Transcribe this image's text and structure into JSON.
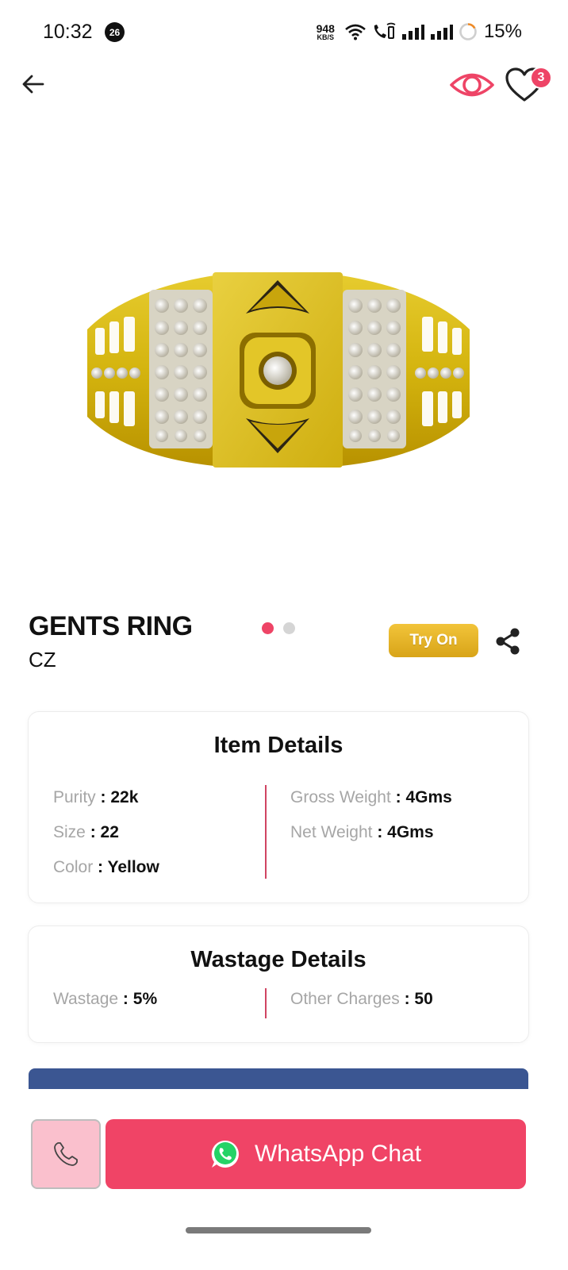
{
  "status_bar": {
    "time": "10:32",
    "notification_count": "26",
    "net_speed_value": "948",
    "net_speed_unit": "KB/S",
    "battery": "15%"
  },
  "header": {
    "wishlist_count": "3"
  },
  "product": {
    "title": "GENTS RING",
    "subtitle": "CZ",
    "image_count": 2,
    "active_image": 1,
    "try_on_label": "Try On"
  },
  "item_details": {
    "title": "Item Details",
    "purity": {
      "label": "Purity",
      "value": "22k"
    },
    "size": {
      "label": "Size",
      "value": "22"
    },
    "color": {
      "label": "Color",
      "value": "Yellow"
    },
    "gross_weight": {
      "label": "Gross Weight",
      "value": "4Gms"
    },
    "net_weight": {
      "label": "Net Weight",
      "value": "4Gms"
    }
  },
  "wastage_details": {
    "title": "Wastage Details",
    "wastage": {
      "label": "Wastage",
      "value": "5%"
    },
    "other_charges": {
      "label": "Other Charges",
      "value": "50"
    }
  },
  "actions": {
    "whatsapp_label": "WhatsApp Chat"
  },
  "colors": {
    "accent": "#ee4466",
    "gold": "#d8a418",
    "whatsapp_green": "#25d366",
    "call_bg": "#fac0cd",
    "strip_blue": "#3b5692"
  },
  "icons": {
    "back": "arrow-left-icon",
    "view": "eye-icon",
    "wishlist": "heart-icon",
    "share": "share-icon",
    "call": "phone-icon",
    "whatsapp": "whatsapp-icon"
  }
}
